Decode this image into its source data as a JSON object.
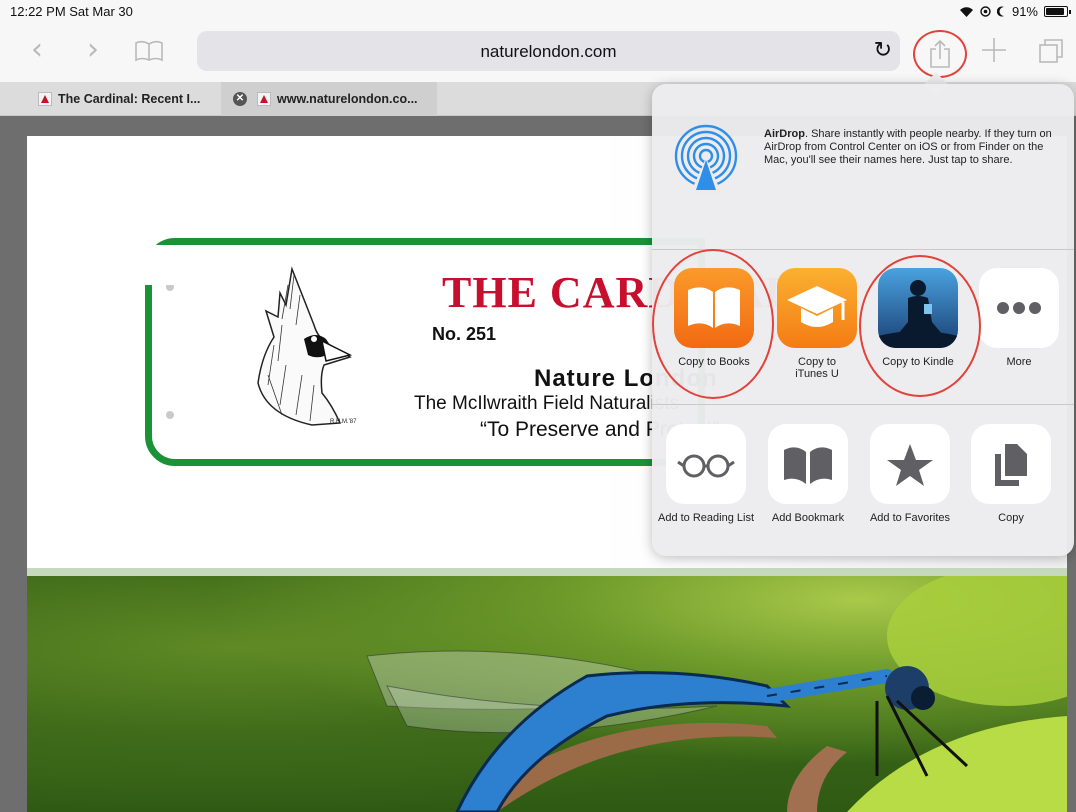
{
  "status_bar": {
    "time_date": "12:22 PM  Sat Mar 30",
    "battery_percent": "91%",
    "battery_level": 0.91
  },
  "toolbar": {
    "url": "naturelondon.com"
  },
  "tabs": [
    {
      "label": "The Cardinal: Recent I...",
      "active": false
    },
    {
      "label": "www.naturelondon.co...",
      "active": true
    }
  ],
  "page": {
    "title": "THE CARDINAL",
    "issue": "No. 251",
    "subtitle": "Nature London",
    "club": "The McIlwraith Field Naturalists",
    "motto": "“To Preserve and Protect”",
    "artist_signature": "R.H.M.'87"
  },
  "share_sheet": {
    "airdrop_title": "AirDrop",
    "airdrop_text": ". Share instantly with people nearby. If they turn on AirDrop from Control Center on iOS or from Finder on the Mac, you'll see their names here. Just tap to share.",
    "apps": [
      {
        "label": "Copy to Books",
        "icon": "books-icon",
        "color": "#f7861e"
      },
      {
        "label": "Copy to iTunes U",
        "icon": "itunes-u-icon",
        "color": "#f89c1c"
      },
      {
        "label": "Copy to Kindle",
        "icon": "kindle-icon",
        "color": "#1f6fb5"
      },
      {
        "label": "More",
        "icon": "more-icon",
        "color": "#ffffff"
      }
    ],
    "actions": [
      {
        "label": "Add to Reading List",
        "icon": "glasses-icon"
      },
      {
        "label": "Add Bookmark",
        "icon": "book-icon"
      },
      {
        "label": "Add to Favorites",
        "icon": "star-icon"
      },
      {
        "label": "Copy",
        "icon": "copy-icon"
      }
    ]
  },
  "colors": {
    "annotation_red": "#e2423a",
    "title_red": "#c8102e",
    "plaque_green": "#1a9337"
  }
}
